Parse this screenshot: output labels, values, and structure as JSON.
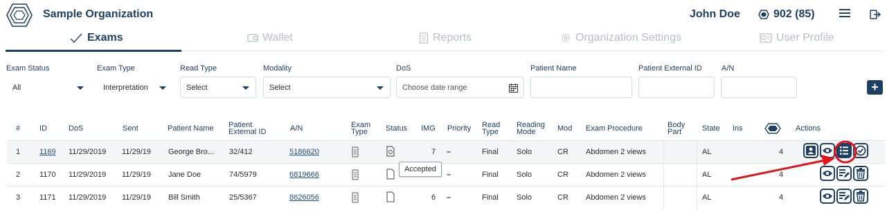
{
  "header": {
    "org_name": "Sample Organization",
    "user_name": "John Doe",
    "credits": "902 (85)"
  },
  "tabs": [
    {
      "label": "Exams",
      "active": true,
      "icon": "checkmark-icon"
    },
    {
      "label": "Wallet",
      "active": false,
      "icon": "wallet-icon"
    },
    {
      "label": "Reports",
      "active": false,
      "icon": "document-icon"
    },
    {
      "label": "Organization Settings",
      "active": false,
      "icon": "gear-icon"
    },
    {
      "label": "User Profile",
      "active": false,
      "icon": "id-card-icon"
    }
  ],
  "filters": {
    "exam_status": {
      "label": "Exam Status",
      "value": "All"
    },
    "exam_type": {
      "label": "Exam Type",
      "value": "Interpretation"
    },
    "read_type": {
      "label": "Read Type",
      "value": "Select"
    },
    "modality": {
      "label": "Modality",
      "value": "Select"
    },
    "dos": {
      "label": "DoS",
      "placeholder": "Choose date range"
    },
    "patient_name": {
      "label": "Patient Name",
      "value": ""
    },
    "patient_external_id": {
      "label": "Patient External ID",
      "value": ""
    },
    "an": {
      "label": "A/N",
      "value": ""
    }
  },
  "add_button": "+",
  "table": {
    "headers": {
      "num": "#",
      "id": "ID",
      "dos": "DoS",
      "sent": "Sent",
      "patient_name": "Patient Name",
      "patient_external_id_1": "Patient",
      "patient_external_id_2": "External ID",
      "an": "A/N",
      "exam_type_1": "Exam",
      "exam_type_2": "Type",
      "status": "Status",
      "img": "IMG",
      "priority": "Priority",
      "read_type_1": "Read",
      "read_type_2": "Type",
      "reading_mode_1": "Reading",
      "reading_mode_2": "Mode",
      "mod": "Mod",
      "exam_procedure": "Exam Procedure",
      "body_part_1": "Body",
      "body_part_2": "Part",
      "state": "State",
      "ins": "Ins",
      "actions": "Actions"
    },
    "rows": [
      {
        "num": "1",
        "id": "1169",
        "dos": "11/29/2019",
        "sent": "11/29/19",
        "patient_name": "George Bro...",
        "patient_external_id": "32/412",
        "an": "5186620",
        "img": "7",
        "priority": "–",
        "read_type": "Final",
        "reading_mode": "Solo",
        "mod": "CR",
        "exam_procedure": "Abdomen 2 views",
        "body_part": "",
        "state": "AL",
        "ins": "",
        "credits": "4"
      },
      {
        "num": "2",
        "id": "1170",
        "dos": "11/29/2019",
        "sent": "11/29/19",
        "patient_name": "Jane Doe",
        "patient_external_id": "74/5979",
        "an": "6819666",
        "img": "",
        "priority": "–",
        "read_type": "Final",
        "reading_mode": "Solo",
        "mod": "CR",
        "exam_procedure": "Abdomen 2 views",
        "body_part": "",
        "state": "AL",
        "ins": "",
        "credits": "4"
      },
      {
        "num": "3",
        "id": "1171",
        "dos": "11/29/2019",
        "sent": "11/29/19",
        "patient_name": "Bill Smith",
        "patient_external_id": "25/5367",
        "an": "8626056",
        "img": "6",
        "priority": "–",
        "read_type": "Final",
        "reading_mode": "Solo",
        "mod": "CR",
        "exam_procedure": "Abdomen 2 views",
        "body_part": "",
        "state": "AL",
        "ins": "",
        "credits": "4"
      }
    ]
  },
  "tooltip": "Accepted",
  "colors": {
    "primary": "#1d3f66",
    "annotation": "#e0161b",
    "muted": "#b8bfc8"
  }
}
